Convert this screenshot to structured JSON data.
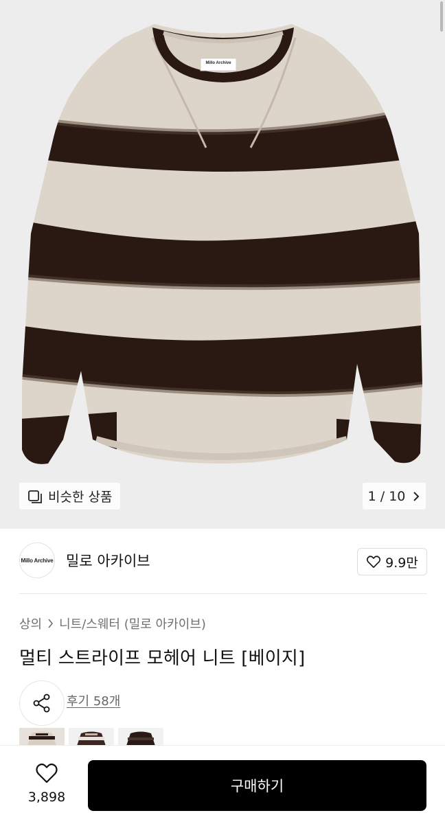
{
  "hero": {
    "label_tag": "Millo Archive",
    "similar_label": "비슷한 상품",
    "counter": "1 / 10"
  },
  "shop": {
    "avatar_text": "Millo Archive",
    "name": "밀로 아카이브",
    "likes": "9.9만"
  },
  "breadcrumb": {
    "category": "상의",
    "subcategory": "니트/스웨터 (밀로 아카이브)"
  },
  "product": {
    "title": "멀티 스트라이프 모헤어 니트 [베이지]",
    "review": "후기 58개"
  },
  "bottom_bar": {
    "wish_count": "3,898",
    "buy_label": "구매하기"
  },
  "colors": {
    "background": "#ededed",
    "knit_beige": "#ddd4c8",
    "stripe_dark": "#2b1a14",
    "buy_button": "#000000"
  },
  "icons": [
    "similar-items-icon",
    "chevron-right-icon",
    "heart-outline-icon",
    "share-icon"
  ]
}
